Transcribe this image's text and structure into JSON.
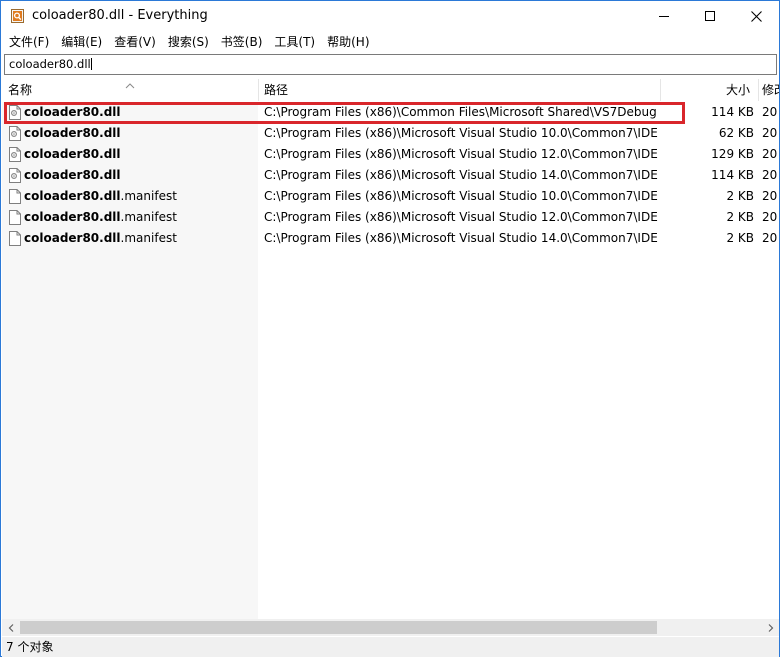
{
  "window": {
    "title": "coloader80.dll - Everything",
    "icons": {
      "app": "everything-app-icon",
      "minimize": "minimize-icon",
      "maximize": "maximize-icon",
      "close": "close-icon"
    }
  },
  "menu": {
    "items": [
      {
        "label": "文件(F)"
      },
      {
        "label": "编辑(E)"
      },
      {
        "label": "查看(V)"
      },
      {
        "label": "搜索(S)"
      },
      {
        "label": "书签(B)"
      },
      {
        "label": "工具(T)"
      },
      {
        "label": "帮助(H)"
      }
    ]
  },
  "search": {
    "value": "coloader80.dll"
  },
  "columns": {
    "name": "名称",
    "path": "路径",
    "size": "大小",
    "modified": "修改"
  },
  "rows": [
    {
      "name_bold": "coloader80.dll",
      "name_rest": "",
      "path": "C:\\Program Files (x86)\\Common Files\\Microsoft Shared\\VS7Debug",
      "size": "114 KB",
      "date": "20",
      "icon": "dll-file-icon"
    },
    {
      "name_bold": "coloader80.dll",
      "name_rest": "",
      "path": "C:\\Program Files (x86)\\Microsoft Visual Studio 10.0\\Common7\\IDE",
      "size": "62 KB",
      "date": "20",
      "icon": "dll-file-icon"
    },
    {
      "name_bold": "coloader80.dll",
      "name_rest": "",
      "path": "C:\\Program Files (x86)\\Microsoft Visual Studio 12.0\\Common7\\IDE",
      "size": "129 KB",
      "date": "20",
      "icon": "dll-file-icon"
    },
    {
      "name_bold": "coloader80.dll",
      "name_rest": "",
      "path": "C:\\Program Files (x86)\\Microsoft Visual Studio 14.0\\Common7\\IDE",
      "size": "114 KB",
      "date": "20",
      "icon": "dll-file-icon"
    },
    {
      "name_bold": "coloader80.dll",
      "name_rest": ".manifest",
      "path": "C:\\Program Files (x86)\\Microsoft Visual Studio 10.0\\Common7\\IDE",
      "size": "2 KB",
      "date": "20",
      "icon": "manifest-file-icon"
    },
    {
      "name_bold": "coloader80.dll",
      "name_rest": ".manifest",
      "path": "C:\\Program Files (x86)\\Microsoft Visual Studio 12.0\\Common7\\IDE",
      "size": "2 KB",
      "date": "20",
      "icon": "manifest-file-icon"
    },
    {
      "name_bold": "coloader80.dll",
      "name_rest": ".manifest",
      "path": "C:\\Program Files (x86)\\Microsoft Visual Studio 14.0\\Common7\\IDE",
      "size": "2 KB",
      "date": "20",
      "icon": "manifest-file-icon"
    }
  ],
  "status": {
    "text": "7 个对象"
  },
  "colors": {
    "highlight": "#d9262b",
    "border": "#2b79d7",
    "name_column_bg": "#f7f7f7"
  }
}
